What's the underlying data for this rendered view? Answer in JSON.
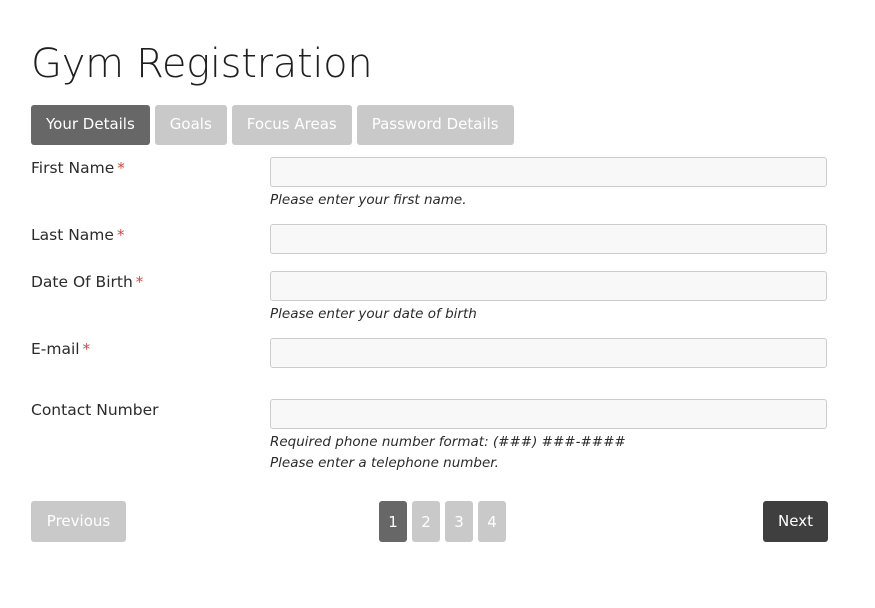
{
  "page": {
    "title": "Gym Registration"
  },
  "tabs": [
    {
      "label": "Your Details",
      "active": true
    },
    {
      "label": "Goals",
      "active": false
    },
    {
      "label": "Focus Areas",
      "active": false
    },
    {
      "label": "Password Details",
      "active": false
    }
  ],
  "form": {
    "fields": [
      {
        "label": "First Name",
        "required": true,
        "required_marker": "*",
        "value": "",
        "placeholder": "",
        "help": [
          "Please enter your first name."
        ]
      },
      {
        "label": "Last Name",
        "required": true,
        "required_marker": "*",
        "value": "",
        "placeholder": "",
        "help": []
      },
      {
        "label": "Date Of Birth",
        "required": true,
        "required_marker": "*",
        "value": "",
        "placeholder": "",
        "help": [
          "Please enter your date of birth"
        ]
      },
      {
        "label": "E-mail",
        "required": true,
        "required_marker": "*",
        "value": "",
        "placeholder": "",
        "help": []
      },
      {
        "label": "Contact Number",
        "required": false,
        "required_marker": "",
        "value": "",
        "placeholder": "",
        "help": [
          "Required phone number format: (###) ###-####",
          "Please enter a telephone number."
        ]
      }
    ]
  },
  "footer": {
    "previous_label": "Previous",
    "next_label": "Next",
    "pages": [
      {
        "label": "1",
        "active": true
      },
      {
        "label": "2",
        "active": false
      },
      {
        "label": "3",
        "active": false
      },
      {
        "label": "4",
        "active": false
      }
    ]
  },
  "colors": {
    "tab_active": "#676767",
    "tab_inactive": "#c9c9c9",
    "next_button": "#3f3f3f",
    "previous_button": "#c9c9c9",
    "required_asterisk": "#d9483f",
    "input_border": "#cccccc",
    "input_fill": "#f8f8f8",
    "title_text": "#1f1f1f",
    "page_background": "#ffffff"
  }
}
